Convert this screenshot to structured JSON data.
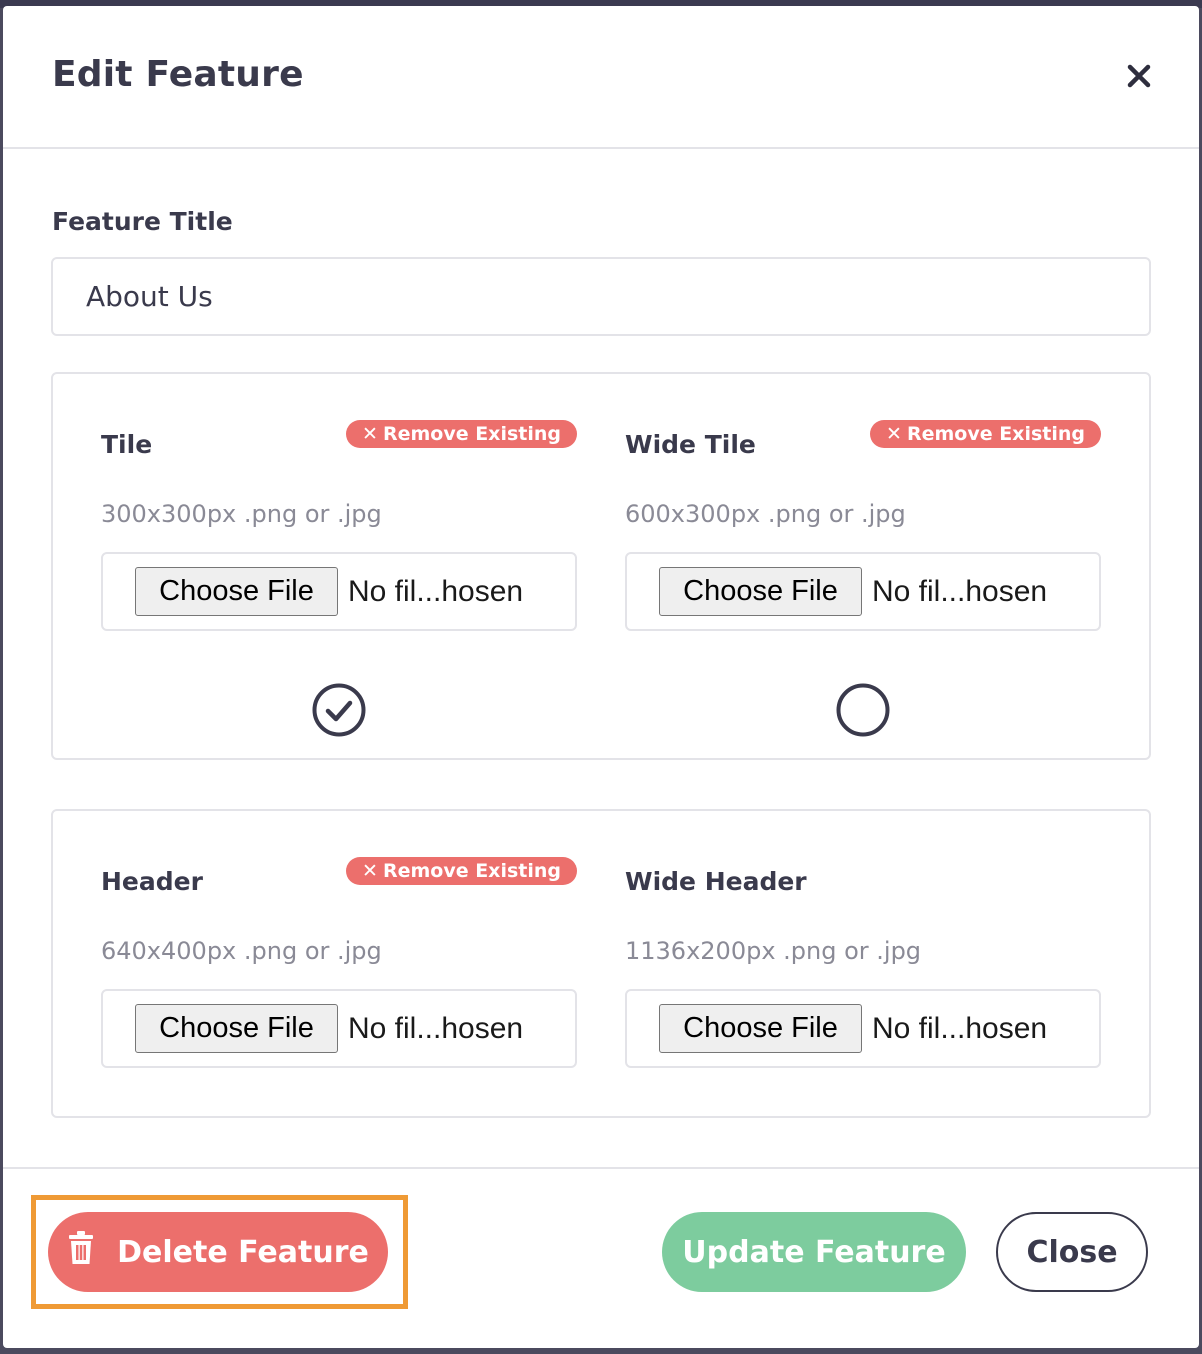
{
  "modal": {
    "title": "Edit Feature",
    "close_icon": "close-icon"
  },
  "form": {
    "title_label": "Feature Title",
    "title_value": "About Us"
  },
  "images": [
    {
      "label": "Tile",
      "hint": "300x300px .png or .jpg",
      "remove_label": "Remove Existing",
      "has_remove": true,
      "choose_label": "Choose File",
      "file_status": "No fil...hosen",
      "selected": true
    },
    {
      "label": "Wide Tile",
      "hint": "600x300px .png or .jpg",
      "remove_label": "Remove Existing",
      "has_remove": true,
      "choose_label": "Choose File",
      "file_status": "No fil...hosen",
      "selected": false
    },
    {
      "label": "Header",
      "hint": "640x400px .png or .jpg",
      "remove_label": "Remove Existing",
      "has_remove": true,
      "choose_label": "Choose File",
      "file_status": "No fil...hosen"
    },
    {
      "label": "Wide Header",
      "hint": "1136x200px .png or .jpg",
      "has_remove": false,
      "choose_label": "Choose File",
      "file_status": "No fil...hosen"
    }
  ],
  "footer": {
    "delete_label": "Delete Feature",
    "update_label": "Update Feature",
    "close_label": "Close"
  },
  "colors": {
    "danger": "#ec6f6c",
    "success": "#7dcc9e",
    "highlight": "#ef9a35",
    "text": "#3a3a4c"
  }
}
